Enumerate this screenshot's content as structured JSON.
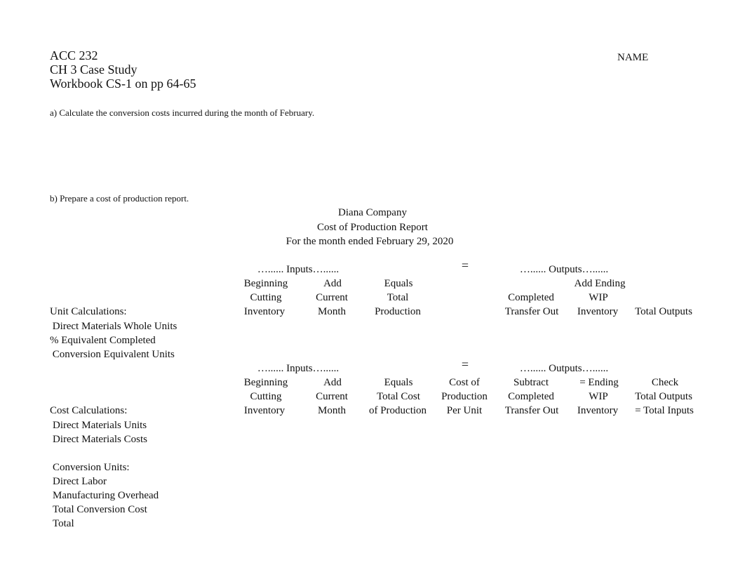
{
  "header": {
    "course": "ACC 232",
    "chapter": "CH 3 Case Study",
    "workbook": "Workbook CS-1 on pp 64-65",
    "name_label": "NAME"
  },
  "questions": {
    "a": "a) Calculate the conversion costs incurred during the month of February.",
    "b": "b) Prepare a cost of production report."
  },
  "report": {
    "company": "Diana Company",
    "title": "Cost of Production Report",
    "period": "For the month ended February 29, 2020"
  },
  "unit_section": {
    "inputs_label": "…...... Inputs…......",
    "equals_sign": "=",
    "outputs_label": "…...... Outputs…......",
    "columns": [
      {
        "lines": [
          "Beginning",
          "Cutting",
          "Inventory"
        ]
      },
      {
        "lines": [
          "Add",
          "Current",
          "Month"
        ]
      },
      {
        "lines": [
          "Equals",
          "Total",
          "Production"
        ]
      },
      {
        "lines": [
          "",
          "Completed",
          "Transfer Out"
        ]
      },
      {
        "lines": [
          "Add Ending",
          "WIP",
          "Inventory"
        ]
      },
      {
        "lines": [
          "",
          "",
          "Total Outputs"
        ]
      }
    ],
    "heading": "Unit Calculations:",
    "rows": [
      " Direct Materials Whole Units",
      "% Equivalent Completed",
      " Conversion Equivalent Units"
    ]
  },
  "cost_section": {
    "inputs_label": "…...... Inputs…......",
    "equals_sign": "=",
    "outputs_label": "…...... Outputs…......",
    "columns": [
      {
        "lines": [
          "Beginning",
          "Cutting",
          "Inventory"
        ]
      },
      {
        "lines": [
          "Add",
          "Current",
          "Month"
        ]
      },
      {
        "lines": [
          "Equals",
          "Total Cost",
          "of Production"
        ]
      },
      {
        "lines": [
          "Cost of",
          "Production",
          "Per Unit"
        ]
      },
      {
        "lines": [
          "Subtract",
          "Completed",
          "Transfer Out"
        ]
      },
      {
        "lines": [
          "= Ending",
          "WIP",
          "Inventory"
        ]
      },
      {
        "lines": [
          "Check",
          "Total Outputs",
          "= Total Inputs"
        ]
      }
    ],
    "heading": "Cost Calculations:",
    "rows": [
      "Direct Materials Units",
      "Direct Materials Costs",
      "",
      "Conversion Units:",
      "Direct Labor",
      "Manufacturing Overhead",
      "Total Conversion Cost",
      "Total"
    ]
  }
}
